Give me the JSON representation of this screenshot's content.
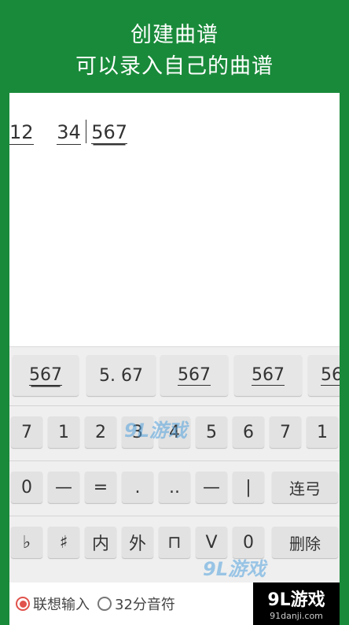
{
  "banner": {
    "line1": "创建曲谱",
    "line2": "可以录入自己的曲谱"
  },
  "score": {
    "g1": "12",
    "g2": "34",
    "g3": "567"
  },
  "suggestions": [
    "567",
    "5. 67",
    "567",
    "567",
    "56"
  ],
  "rows": [
    [
      "7",
      "1",
      "2",
      "3",
      "4",
      "5",
      "6",
      "7",
      "1"
    ],
    [
      "0",
      "—",
      "=",
      ".",
      "..",
      "—",
      "|"
    ],
    [
      "♭",
      "♯",
      "内",
      "外",
      "⊓",
      "V",
      "0"
    ]
  ],
  "side_keys": {
    "slur": "连弓",
    "delete": "删除"
  },
  "bottom": {
    "opt1": "联想输入",
    "opt2": "32分音符"
  },
  "badge": {
    "title": "9L游戏",
    "url": "91danji.com"
  },
  "watermark": "9L游戏"
}
